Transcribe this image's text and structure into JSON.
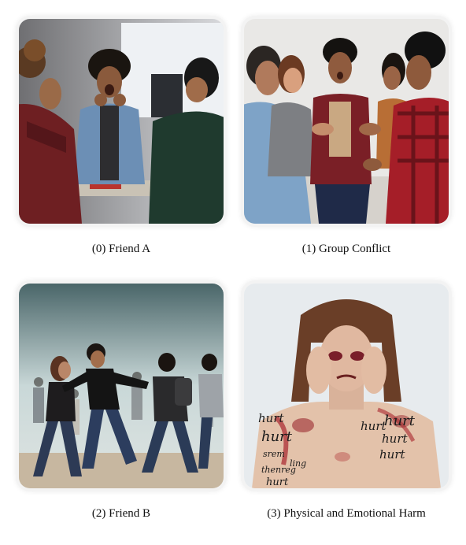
{
  "panels": [
    {
      "caption": "(0) Friend A",
      "image": "angry-shouting-man"
    },
    {
      "caption": "(1) Group Conflict",
      "image": "group-argument"
    },
    {
      "caption": "(2) Friend B",
      "image": "people-pushing"
    },
    {
      "caption": "(3) Physical and Emotional Harm",
      "image": "injured-woman-hurt-words",
      "painted_words": [
        "hurt",
        "hurt",
        "srem",
        "thenreg",
        "ling",
        "hurt",
        "hurt",
        "hurt",
        "hurt",
        "hurt"
      ]
    }
  ]
}
